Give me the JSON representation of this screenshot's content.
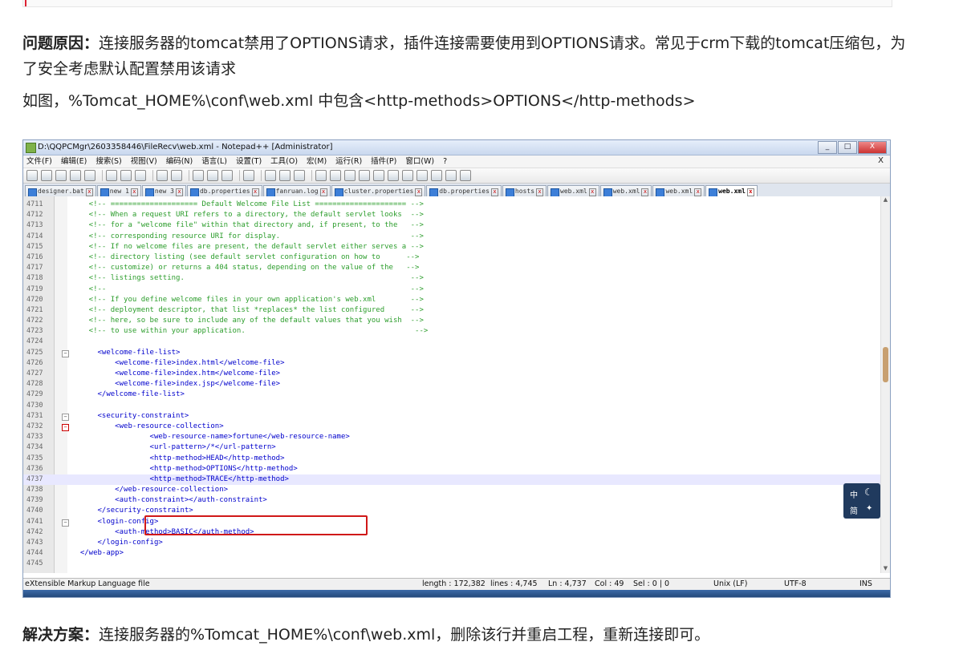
{
  "paragraphs": {
    "cause_label": "问题原因：",
    "cause_text": "连接服务器的tomcat禁用了OPTIONS请求，插件连接需要使用到OPTIONS请求。常见于crm下载的tomcat压缩包，为了安全考虑默认配置禁用该请求",
    "example_text": "如图，%Tomcat_HOME%\\conf\\web.xml 中包含<http-methods>OPTIONS</http-methods>",
    "solution_label": "解决方案：",
    "solution_text": "连接服务器的%Tomcat_HOME%\\conf\\web.xml，删除该行并重启工程，重新连接即可。"
  },
  "screenshot": {
    "window_title": "D:\\QQPCMgr\\2603358446\\FileRecv\\web.xml - Notepad++ [Administrator]",
    "window_buttons": [
      "_",
      "□",
      "X"
    ],
    "menu_items": [
      "文件(F)",
      "编辑(E)",
      "搜索(S)",
      "视图(V)",
      "编码(N)",
      "语言(L)",
      "设置(T)",
      "工具(O)",
      "宏(M)",
      "运行(R)",
      "插件(P)",
      "窗口(W)",
      "?"
    ],
    "menu_close": "X",
    "tabs": [
      "designer.bat",
      "new 1",
      "new 3",
      "db.properties",
      "fanruan.log",
      "cluster.properties",
      "db.properties",
      "hosts",
      "web.xml",
      "web.xml",
      "web.xml",
      "web.xml"
    ],
    "active_tab_index": 11,
    "current_line": 4737,
    "lines": [
      {
        "n": "4711",
        "t": "    <!-- ==================== Default Welcome File List ===================== -->"
      },
      {
        "n": "4712",
        "t": "    <!-- When a request URI refers to a directory, the default servlet looks  -->"
      },
      {
        "n": "4713",
        "t": "    <!-- for a \"welcome file\" within that directory and, if present, to the   -->"
      },
      {
        "n": "4714",
        "t": "    <!-- corresponding resource URI for display.                              -->"
      },
      {
        "n": "4715",
        "t": "    <!-- If no welcome files are present, the default servlet either serves a -->"
      },
      {
        "n": "4716",
        "t": "    <!-- directory listing (see default servlet configuration on how to      -->"
      },
      {
        "n": "4717",
        "t": "    <!-- customize) or returns a 404 status, depending on the value of the   -->"
      },
      {
        "n": "4718",
        "t": "    <!-- listings setting.                                                    -->"
      },
      {
        "n": "4719",
        "t": "    <!--                                                                      -->"
      },
      {
        "n": "4720",
        "t": "    <!-- If you define welcome files in your own application's web.xml        -->"
      },
      {
        "n": "4721",
        "t": "    <!-- deployment descriptor, that list *replaces* the list configured      -->"
      },
      {
        "n": "4722",
        "t": "    <!-- here, so be sure to include any of the default values that you wish  -->"
      },
      {
        "n": "4723",
        "t": "    <!-- to use within your application.                                       -->"
      },
      {
        "n": "4724",
        "t": ""
      },
      {
        "n": "4725",
        "t": "      <welcome-file-list>"
      },
      {
        "n": "4726",
        "t": "          <welcome-file>index.html</welcome-file>"
      },
      {
        "n": "4727",
        "t": "          <welcome-file>index.htm</welcome-file>"
      },
      {
        "n": "4728",
        "t": "          <welcome-file>index.jsp</welcome-file>"
      },
      {
        "n": "4729",
        "t": "      </welcome-file-list>"
      },
      {
        "n": "4730",
        "t": ""
      },
      {
        "n": "4731",
        "t": "      <security-constraint>"
      },
      {
        "n": "4732",
        "t": "          <web-resource-collection>"
      },
      {
        "n": "4733",
        "t": "                  <web-resource-name>fortune</web-resource-name>"
      },
      {
        "n": "4734",
        "t": "                  <url-pattern>/*</url-pattern>"
      },
      {
        "n": "4735",
        "t": "                  <http-method>HEAD</http-method>"
      },
      {
        "n": "4736",
        "t": "                  <http-method>OPTIONS</http-method>"
      },
      {
        "n": "4737",
        "t": "                  <http-method>TRACE</http-method>"
      },
      {
        "n": "4738",
        "t": "          </web-resource-collection>"
      },
      {
        "n": "4739",
        "t": "          <auth-constraint></auth-constraint>"
      },
      {
        "n": "4740",
        "t": "      </security-constraint>"
      },
      {
        "n": "4741",
        "t": "      <login-config>"
      },
      {
        "n": "4742",
        "t": "          <auth-method>BASIC</auth-method>"
      },
      {
        "n": "4743",
        "t": "      </login-config>"
      },
      {
        "n": "4744",
        "t": "  </web-app>"
      },
      {
        "n": "4745",
        "t": ""
      }
    ],
    "status": {
      "file_type": "eXtensible Markup Language file",
      "length": "length : 172,382",
      "lines": "lines : 4,745",
      "ln": "Ln : 4,737",
      "col": "Col : 49",
      "sel": "Sel : 0 | 0",
      "eol": "Unix (LF)",
      "encoding": "UTF-8",
      "mode": "INS"
    },
    "ime": {
      "lang": "中",
      "mode": "简"
    },
    "colors": {
      "highlight_box": "#d01818",
      "tag": "#0000cc",
      "comment": "#2c9d2c"
    }
  }
}
